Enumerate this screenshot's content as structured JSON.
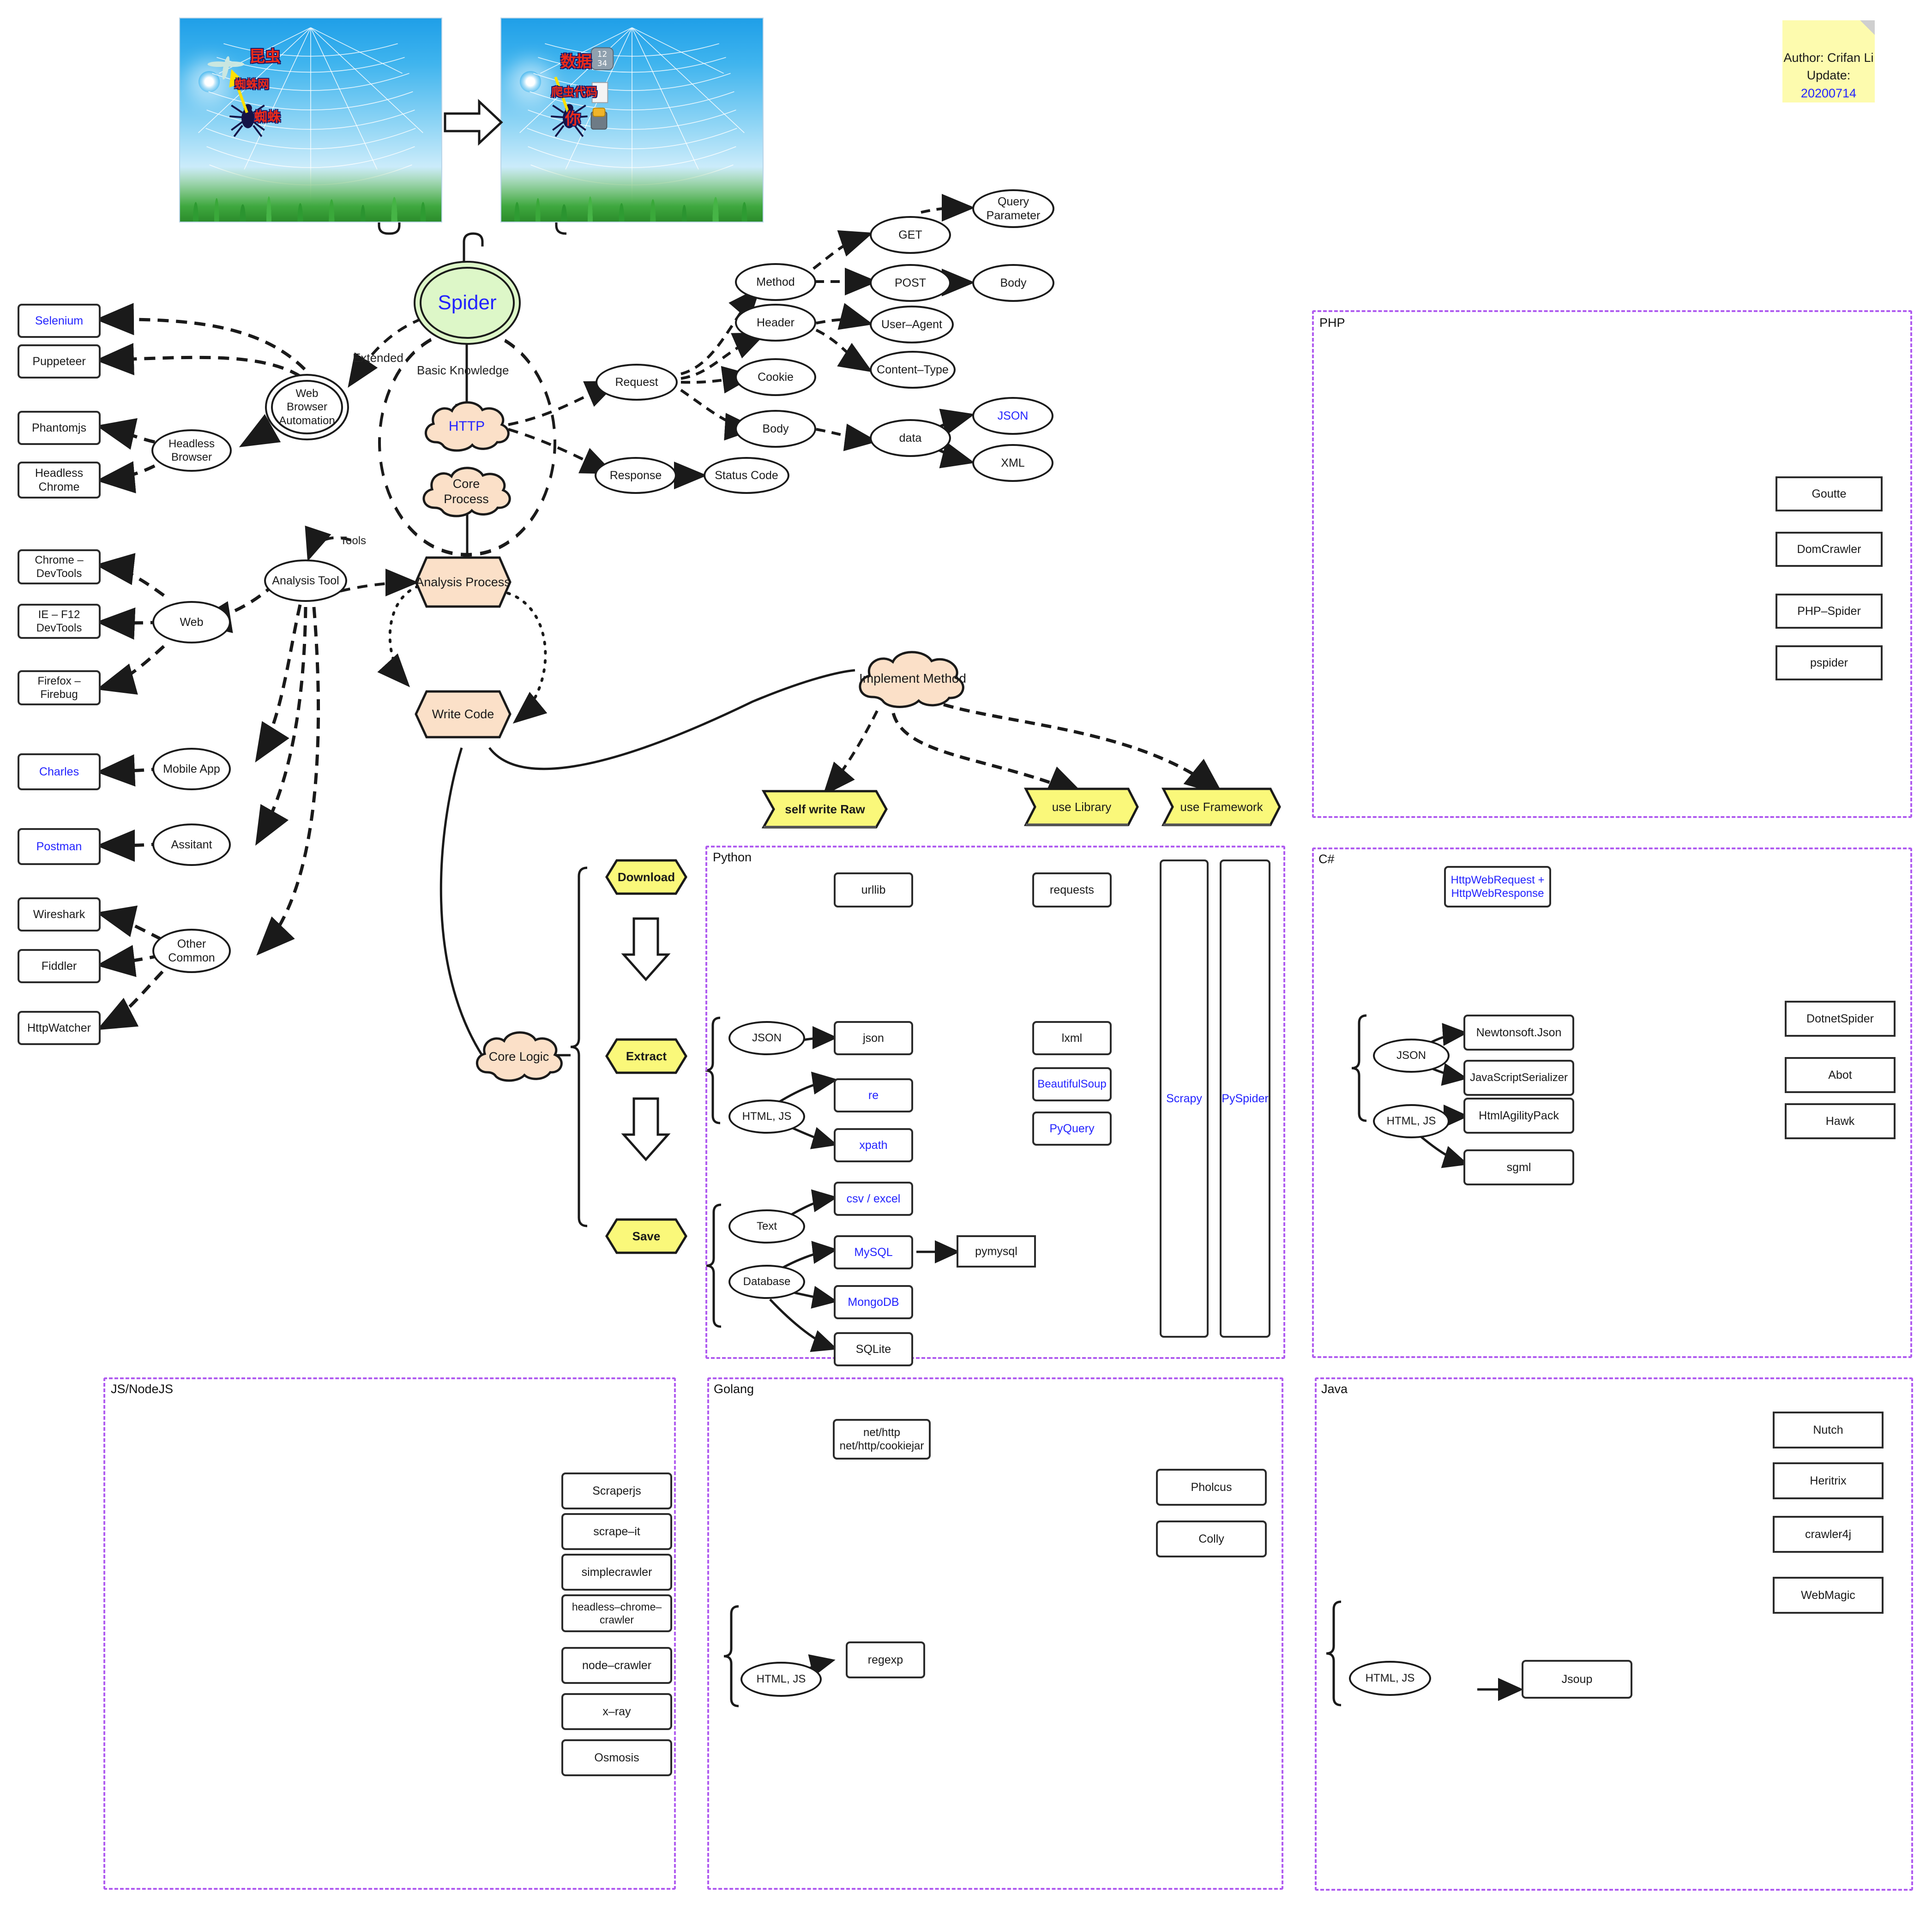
{
  "note": {
    "author_line": "Author: Crifan Li",
    "update_prefix": "Update: ",
    "update_value": "20200714"
  },
  "illustration": {
    "left": {
      "insect": "昆虫",
      "web": "蜘蛛网",
      "spider": "蜘蛛"
    },
    "right": {
      "data": "数据",
      "crawler_code": "爬虫代码",
      "you": "你"
    }
  },
  "root": {
    "label": "Spider"
  },
  "edge_labels": {
    "extended": "Extended",
    "basic_knowledge": "Basic Knowledge",
    "tools": "Tools"
  },
  "core": {
    "http": "HTTP",
    "core_process": "Core Process",
    "analysis_process": "Analysis Process",
    "write_code": "Write Code",
    "core_logic": "Core Logic"
  },
  "browser_automation": {
    "hub": "Web Browser Automation",
    "headless_browser": "Headless Browser",
    "items": [
      {
        "label": "Selenium",
        "highlight": true
      },
      {
        "label": "Puppeteer",
        "highlight": false
      },
      {
        "label": "Phantomjs",
        "highlight": false
      },
      {
        "label": "Headless Chrome",
        "highlight": false
      }
    ]
  },
  "analysis_tool": {
    "hub": "Analysis Tool",
    "groups": [
      {
        "name": "Web",
        "items": [
          "Chrome – DevTools",
          "IE – F12 DevTools",
          "Firefox – Firebug"
        ]
      },
      {
        "name": "Mobile App",
        "items": [
          "Charles"
        ]
      },
      {
        "name": "Assitant",
        "items": [
          "Postman"
        ]
      },
      {
        "name": "Other Common",
        "items": [
          "Wireshark",
          "Fiddler",
          "HttpWatcher"
        ]
      }
    ],
    "highlighted": [
      "Charles",
      "Postman"
    ]
  },
  "http_tree": {
    "request": "Request",
    "response": "Response",
    "status_code": "Status Code",
    "method": "Method",
    "get": "GET",
    "post": "POST",
    "query_parameter": "Query Parameter",
    "body_of_post": "Body",
    "header": "Header",
    "user_agent": "User–Agent",
    "content_type": "Content–Type",
    "cookie": "Cookie",
    "body": "Body",
    "data": "data",
    "json": "JSON",
    "xml": "XML"
  },
  "implement_method": {
    "hub": "Implement Method",
    "options": [
      "self write Raw",
      "use Library",
      "use Framework"
    ]
  },
  "pipeline": {
    "steps": [
      "Download",
      "Extract",
      "Save"
    ]
  },
  "languages": [
    {
      "id": "php",
      "title": "PHP",
      "frameworks": [
        "Goutte",
        "DomCrawler",
        "PHP–Spider",
        "pspider"
      ]
    },
    {
      "id": "python",
      "title": "Python",
      "download": [
        "urllib"
      ],
      "download_lib": [
        "requests"
      ],
      "extract_groups": [
        {
          "name": "JSON",
          "items": [
            {
              "label": "json",
              "highlight": false
            }
          ]
        },
        {
          "name": "HTML, JS",
          "items": [
            {
              "label": "re",
              "highlight": true
            },
            {
              "label": "xpath",
              "highlight": true
            }
          ]
        }
      ],
      "extract_lib": [
        {
          "label": "lxml",
          "highlight": false
        },
        {
          "label": "BeautifulSoup",
          "highlight": true
        },
        {
          "label": "PyQuery",
          "highlight": true
        }
      ],
      "save_groups": [
        {
          "name": "Text",
          "items": [
            {
              "label": "csv / excel",
              "highlight": true
            }
          ]
        },
        {
          "name": "Database",
          "items": [
            {
              "label": "MySQL",
              "highlight": true
            },
            {
              "label": "MongoDB",
              "highlight": true
            },
            {
              "label": "SQLite",
              "highlight": false
            }
          ]
        }
      ],
      "mysql_driver": "pymysql",
      "frameworks": [
        {
          "label": "Scrapy",
          "highlight": true
        },
        {
          "label": "PySpider",
          "highlight": true
        }
      ]
    },
    {
      "id": "csharp",
      "title": "C#",
      "download": [
        "HttpWebRequest + HttpWebResponse"
      ],
      "extract_groups": [
        {
          "name": "JSON",
          "items": [
            "Newtonsoft.Json",
            "JavaScriptSerializer"
          ]
        },
        {
          "name": "HTML, JS",
          "items": [
            "HtmlAgilityPack",
            "sgml"
          ]
        }
      ],
      "frameworks": [
        "DotnetSpider",
        "Abot",
        "Hawk"
      ]
    },
    {
      "id": "jsnodejs",
      "title": "JS/NodeJS",
      "frameworks": [
        "Scraperjs",
        "scrape–it",
        "simplecrawler",
        "headless–chrome–crawler",
        "node–crawler",
        "x–ray",
        "Osmosis"
      ]
    },
    {
      "id": "golang",
      "title": "Golang",
      "download": [
        "net/http\nnet/http/cookiejar"
      ],
      "extract_groups": [
        {
          "name": "HTML, JS",
          "items": [
            "regexp"
          ]
        }
      ],
      "frameworks": [
        "Pholcus",
        "Colly"
      ]
    },
    {
      "id": "java",
      "title": "Java",
      "extract_groups": [
        {
          "name": "HTML, JS",
          "items": [
            "Jsoup"
          ]
        }
      ],
      "frameworks": [
        "Nutch",
        "Heritrix",
        "crawler4j",
        "WebMagic"
      ]
    }
  ],
  "colors": {
    "accent_blue": "#2323ff",
    "cloud_fill": "#fbe0c8",
    "hex_yellow": "#faf87a",
    "spider_green": "#ddf7c8",
    "frame_purple": "#b05cf0",
    "sticky_yellow": "#fdfbae"
  }
}
